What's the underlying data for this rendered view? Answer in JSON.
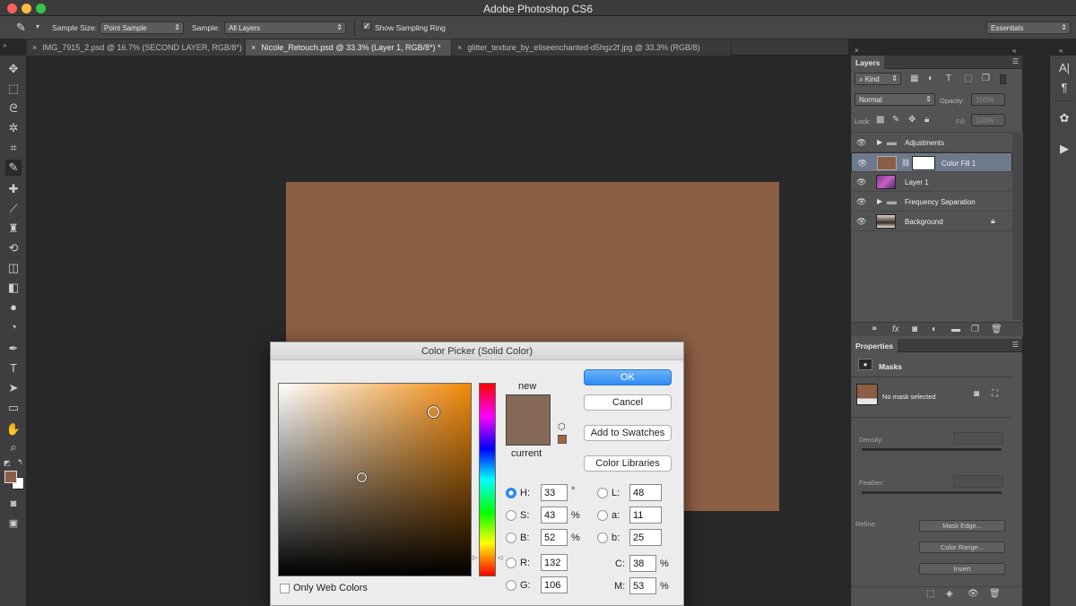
{
  "app": {
    "title": "Adobe Photoshop CS6"
  },
  "options_bar": {
    "sample_size_label": "Sample Size:",
    "sample_size_value": "Point Sample",
    "sample_label": "Sample:",
    "sample_value": "All Layers",
    "sampling_ring_label": "Show Sampling Ring",
    "sampling_ring_checked": true,
    "workspace": "Essentials"
  },
  "tabs": [
    {
      "label": "IMG_7915_2.psd @ 16.7% (SECOND LAYER, RGB/8*)"
    },
    {
      "label": "Nicole_Retouch.psd @ 33.3% (Layer 1, RGB/8*) *"
    },
    {
      "label": "glitter_texture_by_eliseenchanted-d5hgz2f.jpg @ 33.3% (RGB/8)"
    }
  ],
  "document": {
    "fill_color": "#8b5f45"
  },
  "color_picker": {
    "title": "Color Picker (Solid Color)",
    "new_label": "new",
    "current_label": "current",
    "new_color": "#846a56",
    "current_color": "#846a56",
    "swatch_small_color": "#a2673f",
    "ok": "OK",
    "cancel": "Cancel",
    "add_to_swatches": "Add to Swatches",
    "color_libraries": "Color Libraries",
    "only_web_colors": "Only Web Colors",
    "fields": {
      "H": {
        "label": "H:",
        "value": "33",
        "unit": "°"
      },
      "S": {
        "label": "S:",
        "value": "43",
        "unit": "%"
      },
      "B": {
        "label": "B:",
        "value": "52",
        "unit": "%"
      },
      "R": {
        "label": "R:",
        "value": "132"
      },
      "G": {
        "label": "G:",
        "value": "106"
      },
      "L": {
        "label": "L:",
        "value": "48"
      },
      "a": {
        "label": "a:",
        "value": "11"
      },
      "b": {
        "label": "b:",
        "value": "25"
      },
      "C": {
        "label": "C:",
        "value": "38",
        "unit": "%"
      },
      "M": {
        "label": "M:",
        "value": "53",
        "unit": "%"
      }
    }
  },
  "layers_panel": {
    "title": "Layers",
    "filter_kind": "Kind",
    "blend_mode": "Normal",
    "opacity_label": "Opacity:",
    "opacity_value": "100%",
    "lock_label": "Lock:",
    "fill_label": "Fill:",
    "fill_value": "100%",
    "layers": [
      {
        "name": "Adjustments",
        "type": "group"
      },
      {
        "name": "Color Fill 1",
        "type": "fill",
        "selected": true
      },
      {
        "name": "Layer 1",
        "type": "pixel"
      },
      {
        "name": "Frequency Separation",
        "type": "group"
      },
      {
        "name": "Background",
        "type": "background",
        "locked": true
      }
    ]
  },
  "properties_panel": {
    "title": "Properties",
    "section": "Masks",
    "status": "No mask selected",
    "density_label": "Density:",
    "feather_label": "Feather:",
    "refine_label": "Refine:",
    "mask_edge": "Mask Edge...",
    "color_range": "Color Range...",
    "invert": "Invert"
  },
  "colors": {
    "foreground": "#8b5f45",
    "background": "#ffffff",
    "accent": "#2e8af3"
  }
}
